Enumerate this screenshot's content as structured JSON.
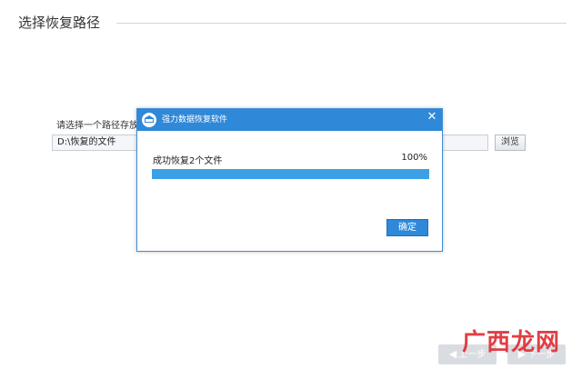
{
  "page": {
    "section_title": "选择恢复路径",
    "path_label": "请选择一个路径存放恢",
    "path_value": "D:\\恢复的文件",
    "browse_label": "浏览",
    "prev_label": "上一步",
    "next_label": "下一步",
    "watermark": "广西龙网"
  },
  "dialog": {
    "title": "强力数据恢复软件",
    "status_text": "成功恢复2个文件",
    "percent_text": "100%",
    "progress": 1.0,
    "ok_label": "确定"
  },
  "colors": {
    "accent": "#2f88d8",
    "progress_fill": "#3ca0e6",
    "watermark": "#e0343a"
  }
}
